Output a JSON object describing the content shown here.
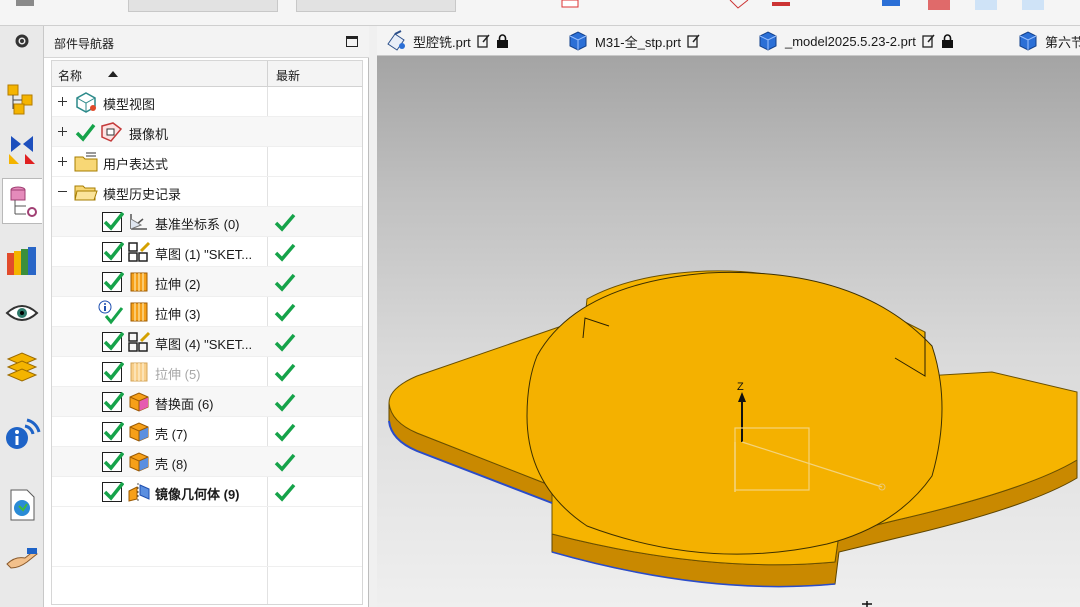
{
  "navigator": {
    "title": "部件导航器",
    "col_name": "名称",
    "col_latest": "最新",
    "rows": [
      {
        "label": "模型视图",
        "icon": "model-views-icon"
      },
      {
        "label": "摄像机",
        "icon": "camera-icon"
      },
      {
        "label": "用户表达式",
        "icon": "folder-icon"
      },
      {
        "label": "模型历史记录",
        "icon": "folder-icon"
      },
      {
        "label": "基准坐标系 (0)",
        "icon": "datum-csys-icon"
      },
      {
        "label": "草图 (1) \"SKET...",
        "icon": "sketch-icon"
      },
      {
        "label": "拉伸 (2)",
        "icon": "extrude-icon"
      },
      {
        "label": "拉伸 (3)",
        "icon": "extrude-icon"
      },
      {
        "label": "草图 (4) \"SKET...",
        "icon": "sketch-icon"
      },
      {
        "label": "拉伸 (5)",
        "icon": "extrude-icon"
      },
      {
        "label": "替换面 (6)",
        "icon": "replace-face-icon"
      },
      {
        "label": "壳 (7)",
        "icon": "shell-icon"
      },
      {
        "label": "壳 (8)",
        "icon": "shell-icon"
      },
      {
        "label": "镜像几何体 (9)",
        "icon": "mirror-geometry-icon"
      }
    ]
  },
  "tabs": [
    {
      "label": "型腔铣.prt",
      "icon": "cam-part-icon"
    },
    {
      "label": "M31-全_stp.prt",
      "icon": "part-icon"
    },
    {
      "label": "_model2025.5.23-2.prt",
      "icon": "part-icon"
    },
    {
      "label": "第六节",
      "icon": "part-icon"
    }
  ],
  "resource_bar": [
    "settings-icon",
    "assembly-navigator-icon",
    "constraint-navigator-icon",
    "part-navigator-icon",
    "reuse-library-icon",
    "visual-icon",
    "layer-icon",
    "info-icon",
    "history-icon",
    "roles-icon"
  ],
  "viewport": {
    "axis_label_z": "Z",
    "part_color": "#f6b400",
    "part_side_color": "#c98900"
  }
}
